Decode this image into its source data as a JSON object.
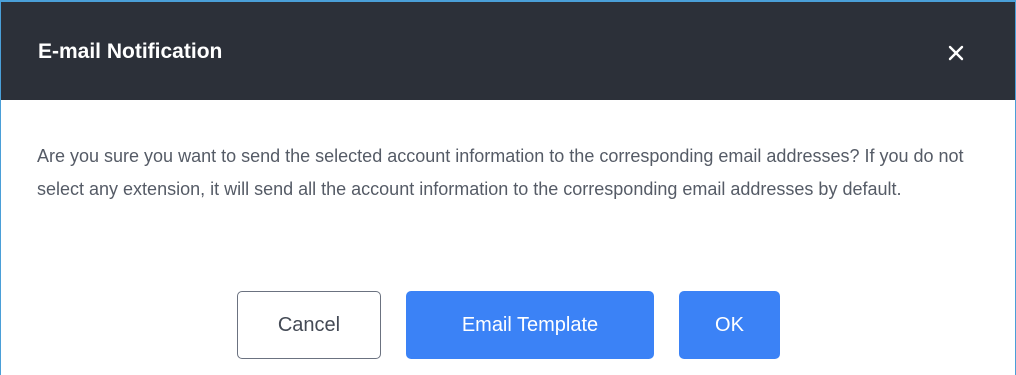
{
  "dialog": {
    "title": "E-mail Notification",
    "close_icon": "close-icon",
    "message": "Are you sure you want to send the selected account information to the corresponding email addresses? If you do not select any extension, it will send all the account information to the corresponding email addresses by default.",
    "buttons": {
      "cancel_label": "Cancel",
      "template_label": "Email Template",
      "ok_label": "OK"
    }
  },
  "colors": {
    "header_background": "#2c3039",
    "primary_button": "#3b82f6",
    "border_accent": "#4a9fd8",
    "body_text": "#555b66"
  }
}
